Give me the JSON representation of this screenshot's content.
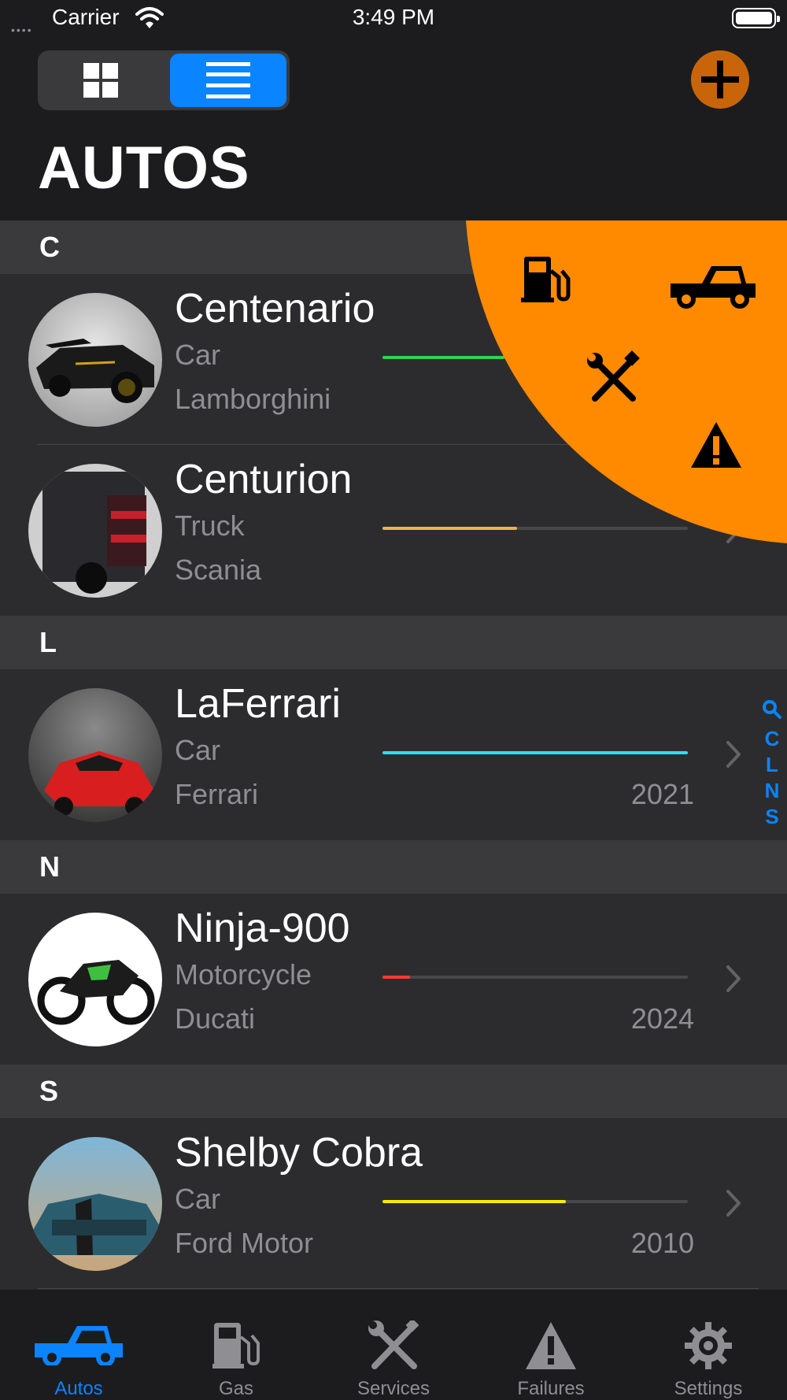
{
  "status_bar": {
    "carrier": "Carrier",
    "time": "3:49 PM"
  },
  "header": {
    "title": "AUTOS",
    "view_modes": [
      "grid-view",
      "list-view"
    ],
    "selected_view": "list-view"
  },
  "colors": {
    "accent": "#0a84ff",
    "orange": "#ff8a00",
    "add_button": "#c8650a",
    "row_bg": "#2c2c2e",
    "section_bg": "#3a3a3c"
  },
  "list": {
    "sections": [
      {
        "letter": "C",
        "rows": [
          {
            "name": "Centenario",
            "type": "Car",
            "make": "Lamborghini",
            "year": "",
            "progress": 0.4,
            "bar_color": "#30d158"
          },
          {
            "name": "Centurion",
            "type": "Truck",
            "make": "Scania",
            "year": "",
            "progress": 0.44,
            "bar_color": "#e8b54a"
          }
        ]
      },
      {
        "letter": "L",
        "rows": [
          {
            "name": "LaFerrari",
            "type": "Car",
            "make": "Ferrari",
            "year": "2021",
            "progress": 1.0,
            "bar_color": "#28e0f0"
          }
        ]
      },
      {
        "letter": "N",
        "rows": [
          {
            "name": "Ninja-900",
            "type": "Motorcycle",
            "make": "Ducati",
            "year": "2024",
            "progress": 0.09,
            "bar_color": "#ff3b30"
          }
        ]
      },
      {
        "letter": "S",
        "rows": [
          {
            "name": "Shelby Cobra",
            "type": "Car",
            "make": "Ford Motor",
            "year": "2010",
            "progress": 0.6,
            "bar_color": "#ffea00"
          }
        ]
      }
    ]
  },
  "index_bar": [
    "C",
    "L",
    "N",
    "S"
  ],
  "quick_menu": {
    "icons": [
      "gas-pump-icon",
      "car-icon",
      "wrench-screwdriver-icon",
      "warning-icon"
    ]
  },
  "tabs": [
    {
      "label": "Autos",
      "icon": "car-icon",
      "active": true
    },
    {
      "label": "Gas",
      "icon": "gas-pump-icon",
      "active": false
    },
    {
      "label": "Services",
      "icon": "wrench-screwdriver-icon",
      "active": false
    },
    {
      "label": "Failures",
      "icon": "warning-icon",
      "active": false
    },
    {
      "label": "Settings",
      "icon": "gear-icon",
      "active": false
    }
  ]
}
